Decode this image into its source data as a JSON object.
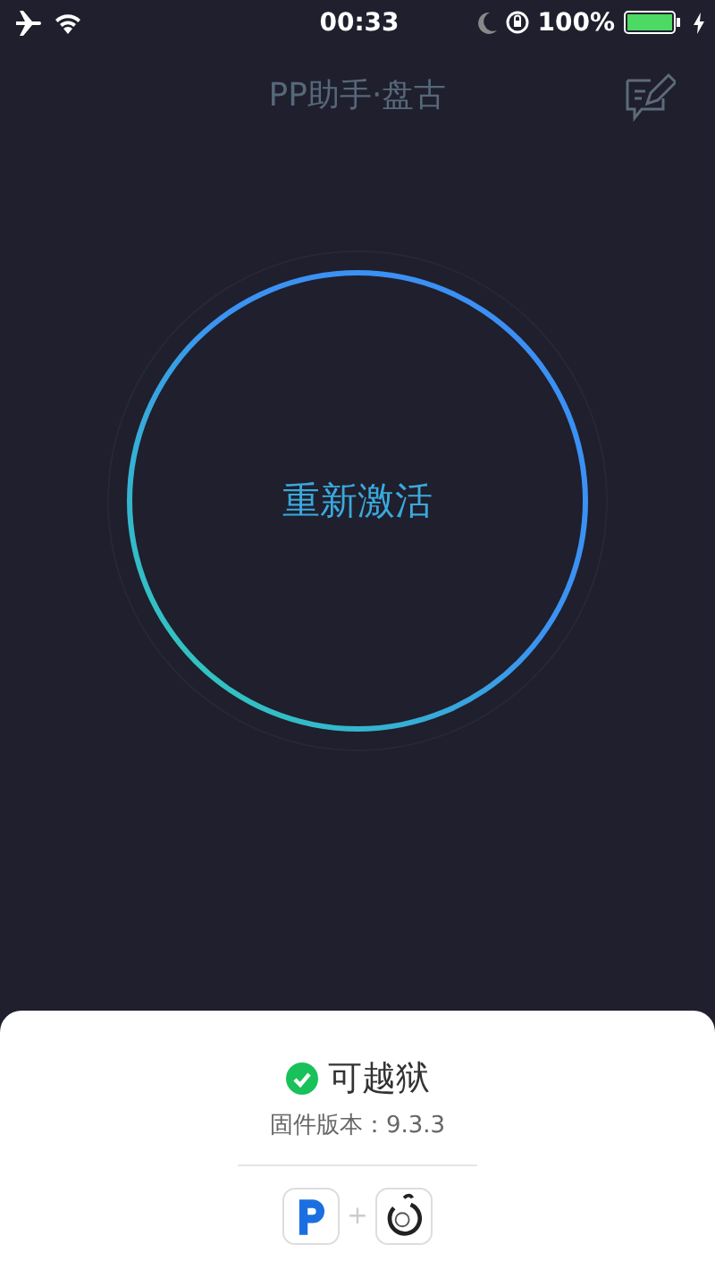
{
  "status_bar": {
    "time": "00:33",
    "battery": "100%"
  },
  "header": {
    "title": "PP助手·盘古"
  },
  "main_button": {
    "label": "重新激活"
  },
  "result": {
    "status": "可越狱",
    "ok": true,
    "firmware": "固件版本：9.3.3",
    "apps_separator": "+"
  }
}
